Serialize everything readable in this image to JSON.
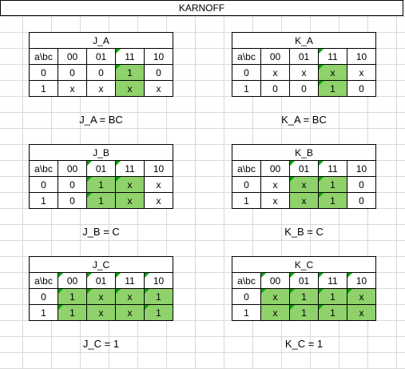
{
  "title": "KARNOFF",
  "corner": "a\\bc",
  "cols": [
    "00",
    "01",
    "11",
    "10"
  ],
  "rows": [
    "0",
    "1"
  ],
  "maps": [
    {
      "name": "J_A",
      "eq": "J_A = BC",
      "cells": [
        [
          "0",
          "0",
          "1",
          "0"
        ],
        [
          "x",
          "x",
          "x",
          "x"
        ]
      ],
      "green": [
        [
          0,
          0,
          1,
          0
        ],
        [
          0,
          0,
          1,
          0
        ]
      ]
    },
    {
      "name": "K_A",
      "eq": "K_A = BC",
      "cells": [
        [
          "x",
          "x",
          "x",
          "x"
        ],
        [
          "0",
          "0",
          "1",
          "0"
        ]
      ],
      "green": [
        [
          0,
          0,
          1,
          0
        ],
        [
          0,
          0,
          1,
          0
        ]
      ]
    },
    {
      "name": "J_B",
      "eq": "J_B = C",
      "cells": [
        [
          "0",
          "1",
          "x",
          "x"
        ],
        [
          "0",
          "1",
          "x",
          "x"
        ]
      ],
      "green": [
        [
          0,
          1,
          1,
          0
        ],
        [
          0,
          1,
          1,
          0
        ]
      ]
    },
    {
      "name": "K_B",
      "eq": "K_B = C",
      "cells": [
        [
          "x",
          "x",
          "1",
          "0"
        ],
        [
          "x",
          "x",
          "1",
          "0"
        ]
      ],
      "green": [
        [
          0,
          1,
          1,
          0
        ],
        [
          0,
          1,
          1,
          0
        ]
      ]
    },
    {
      "name": "J_C",
      "eq": "J_C = 1",
      "cells": [
        [
          "1",
          "x",
          "x",
          "1"
        ],
        [
          "1",
          "x",
          "x",
          "1"
        ]
      ],
      "green": [
        [
          1,
          1,
          1,
          1
        ],
        [
          1,
          1,
          1,
          1
        ]
      ]
    },
    {
      "name": "K_C",
      "eq": "K_C = 1",
      "cells": [
        [
          "x",
          "1",
          "1",
          "x"
        ],
        [
          "x",
          "1",
          "1",
          "x"
        ]
      ],
      "green": [
        [
          1,
          1,
          1,
          1
        ],
        [
          1,
          1,
          1,
          1
        ]
      ]
    }
  ],
  "colors": {
    "green": "#8fd16b",
    "marker": "#00aa00"
  }
}
